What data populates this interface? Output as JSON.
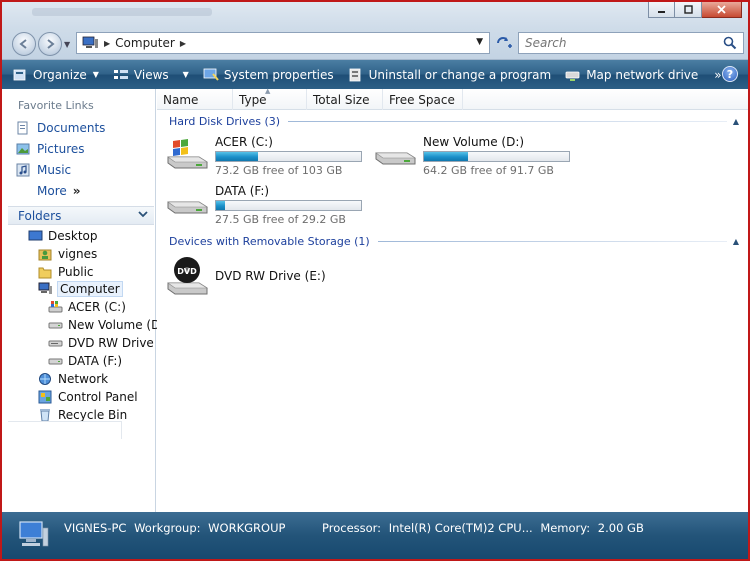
{
  "window": {
    "caption_buttons": [
      "minimize",
      "maximize",
      "close"
    ]
  },
  "address": {
    "crumb": "Computer",
    "search_placeholder": "Search"
  },
  "toolbar": {
    "items": [
      {
        "label": "Organize",
        "icon": "organize-icon",
        "dropdown": true
      },
      {
        "label": "Views",
        "icon": "views-icon",
        "dropdown": true
      },
      {
        "label": "System properties",
        "icon": "system-properties-icon"
      },
      {
        "label": "Uninstall or change a program",
        "icon": "uninstall-icon"
      },
      {
        "label": "Map network drive",
        "icon": "map-drive-icon"
      }
    ],
    "more": "»",
    "help": "?"
  },
  "navpane": {
    "favorites_header": "Favorite Links",
    "favorites": [
      "Documents",
      "Pictures",
      "Music"
    ],
    "more_label": "More",
    "more_chevron": "»",
    "folders_header": "Folders",
    "tree": [
      {
        "label": "Desktop",
        "icon": "desktop-icon"
      },
      {
        "label": "vignes",
        "icon": "user-folder-icon"
      },
      {
        "label": "Public",
        "icon": "folder-icon"
      },
      {
        "label": "Computer",
        "icon": "computer-icon"
      },
      {
        "label": "ACER (C:)",
        "icon": "system-drive-icon"
      },
      {
        "label": "New Volume (D:)",
        "icon": "drive-icon"
      },
      {
        "label": "DVD RW Drive (E:)",
        "icon": "dvd-drive-icon"
      },
      {
        "label": "DATA (F:)",
        "icon": "drive-icon"
      },
      {
        "label": "Network",
        "icon": "network-icon"
      },
      {
        "label": "Control Panel",
        "icon": "control-panel-icon"
      },
      {
        "label": "Recycle Bin",
        "icon": "recycle-bin-icon"
      }
    ]
  },
  "columns": [
    "Name",
    "Type",
    "Total Size",
    "Free Space"
  ],
  "groups": {
    "hdd": "Hard Disk Drives (3)",
    "removable": "Devices with Removable Storage (1)"
  },
  "drives": [
    {
      "name": "ACER (C:)",
      "free": "73.2 GB free of 103 GB",
      "used_fraction": 0.29
    },
    {
      "name": "New Volume (D:)",
      "free": "64.2 GB free of 91.7 GB",
      "used_fraction": 0.3
    },
    {
      "name": "DATA (F:)",
      "free": "27.5 GB free of 29.2 GB",
      "used_fraction": 0.06
    }
  ],
  "dvd": {
    "name": "DVD RW Drive (E:)",
    "icon_label": "DVD"
  },
  "details": {
    "computer_name": "VIGNES-PC",
    "workgroup_label": "Workgroup:",
    "workgroup_value": "WORKGROUP",
    "processor_label": "Processor:",
    "processor_value": "Intel(R) Core(TM)2 CPU...",
    "memory_label": "Memory:",
    "memory_value": "2.00 GB"
  },
  "colors": {
    "toolbar": "#2f6188",
    "link": "#1c4f9c",
    "bar_fill": "#1b8fc9",
    "frame": "#c01818"
  }
}
